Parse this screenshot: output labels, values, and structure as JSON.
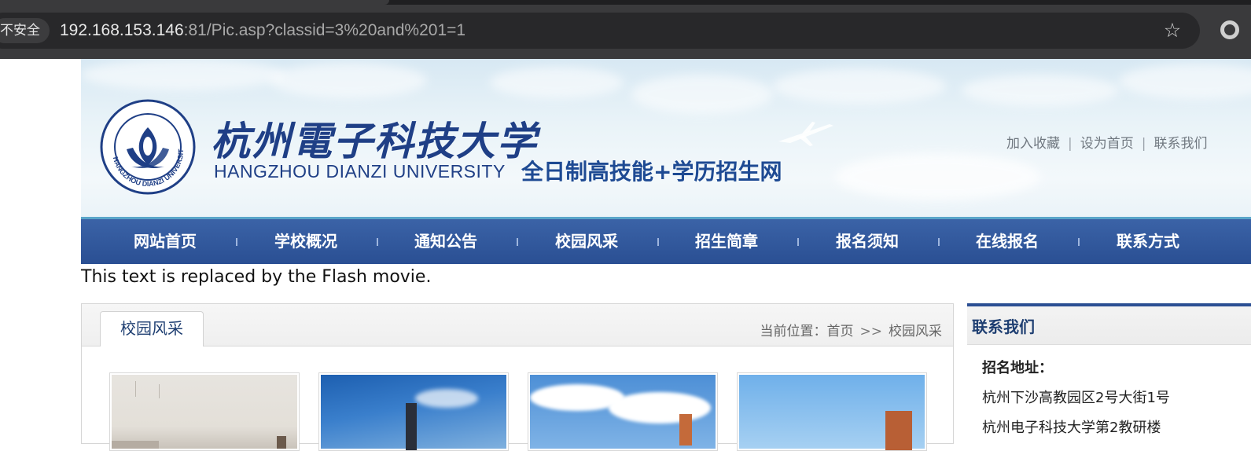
{
  "browser": {
    "security_badge": "不安全",
    "url_host": "192.168.153.146",
    "url_rest": ":81/Pic.asp?classid=3%20and%201=1",
    "bookmark_icon": "star-icon",
    "extension_icon": "extension-icon"
  },
  "header": {
    "logo_cn": "杭州電子科技大学",
    "logo_en": "HANGZHOU DIANZI UNIVERSITY",
    "seal_text": "HANGZHOU DIANZI UNIVERSITY",
    "tagline": "全日制高技能+学历招生网",
    "links": [
      "加入收藏",
      "设为首页",
      "联系我们"
    ]
  },
  "nav": {
    "items": [
      "网站首页",
      "学校概况",
      "通知公告",
      "校园风采",
      "招生简章",
      "报名须知",
      "在线报名",
      "联系方式"
    ]
  },
  "flash_placeholder": "This text is replaced by the Flash movie.",
  "main": {
    "tab_label": "校园风采",
    "breadcrumb_prefix": "当前位置：",
    "breadcrumb_home": "首页",
    "breadcrumb_sep": ">>",
    "breadcrumb_current": "校园风采"
  },
  "sidebar": {
    "title": "联系我们",
    "address_label": "招名地址：",
    "address_line1": "杭州下沙高教园区2号大街1号",
    "address_line2": "杭州电子科技大学第2教研楼"
  },
  "colors": {
    "nav_blue": "#2a4f93",
    "brand_blue": "#1f3f86"
  }
}
